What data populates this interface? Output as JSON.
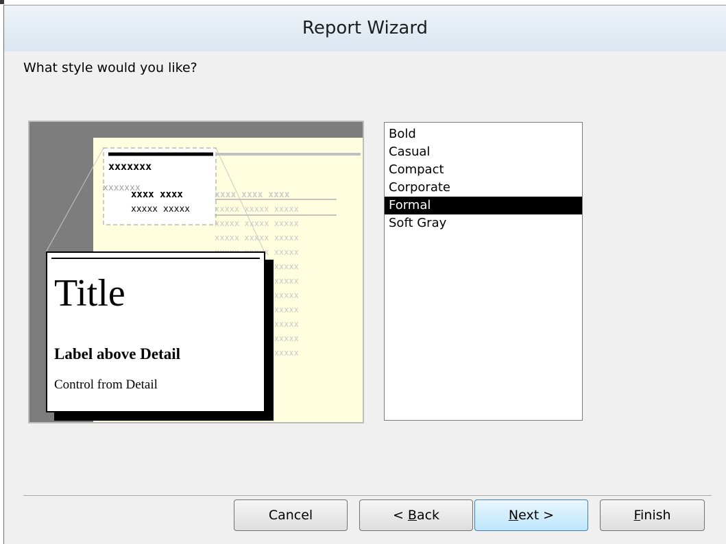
{
  "window": {
    "title": "Report Wizard"
  },
  "prompt": "What style would you like?",
  "preview": {
    "header_row": "xxxxxxx",
    "subheader_row": "xxxxxxx",
    "bold_row": "xxxx xxxx",
    "bold_row_faded": "xxxx xxxx xxxx",
    "detail_row": "xxxxx xxxxx",
    "detail_row_faded": "xxxxx xxxxx xxxxx",
    "card": {
      "title": "Title",
      "label": "Label above Detail",
      "control": "Control from Detail"
    }
  },
  "styles": {
    "items": [
      "Bold",
      "Casual",
      "Compact",
      "Corporate",
      "Formal",
      "Soft Gray"
    ],
    "selected": "Formal"
  },
  "buttons": {
    "cancel": "Cancel",
    "back_prefix": "< ",
    "back_mnemonic": "B",
    "back_rest": "ack",
    "next_mnemonic": "N",
    "next_rest": "ext >",
    "finish_mnemonic": "F",
    "finish_rest": "inish"
  },
  "colors": {
    "preview_background": "#7d7d7d",
    "report_page": "#ffffe0",
    "selection": "#000000"
  }
}
